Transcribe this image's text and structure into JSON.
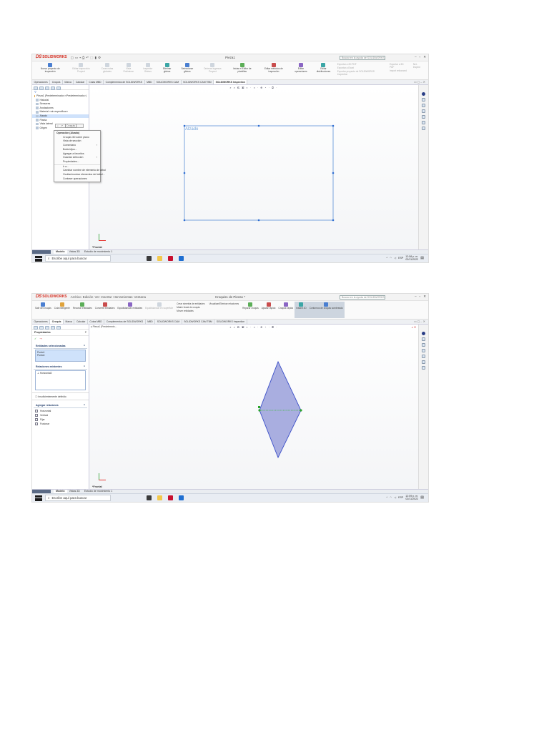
{
  "shot1": {
    "logo": "SOLIDWORKS",
    "doc_title": "Pieza1",
    "search_placeholder": "Buscar en la ayuda de SOLIDWORKS",
    "ribbon": [
      {
        "label": "Nuevo proyecto de inspección",
        "dim": false
      },
      {
        "label": "Editar inspección Proyect",
        "dim": true
      },
      {
        "label": "Crear notas globales",
        "dim": true
      },
      {
        "label": "Vista Preliminar",
        "dim": true
      },
      {
        "label": "Inspector Globos",
        "dim": true
      },
      {
        "label": "Eliminar globos",
        "dim": false
      },
      {
        "label": "Seleccionar globos",
        "dim": false
      },
      {
        "label": "Ordenar ingresos Proyect",
        "dim": true
      },
      {
        "label": "Iniciar el Editor de plantillas",
        "dim": false
      },
      {
        "label": "Editar métodos de inspección",
        "dim": false
      },
      {
        "label": "Editar operaciones",
        "dim": false
      },
      {
        "label": "Editar distribuciones",
        "dim": false
      }
    ],
    "ribbon_col1": [
      "Exportar a 2D PDF",
      "Exportar a Excel",
      "Exportar proyecto de SOLIDWORKS Inspection"
    ],
    "ribbon_col2": [
      "Exportar a 3D PDF",
      "Import enhanced"
    ],
    "ribbon_col3": [
      "Net-Inspect"
    ],
    "tabs": [
      "Operaciones",
      "Croquis",
      "Marca",
      "Calcular",
      "Cotas MBD",
      "Complementos de SOLIDWORKS",
      "MBD",
      "SOLIDWORKS CAM",
      "SOLIDWORKS CAM TBM",
      "SOLIDWORKS Inspection"
    ],
    "active_tab": 9,
    "tree": [
      "Pieza1 (Predeterminado<<Predeterminado>)",
      "Historial",
      "Sensores",
      "Anotaciones",
      "Material <sin especificar>",
      "Alzado",
      "Planta",
      "Vista lateral",
      "Origen"
    ],
    "ctx_mini": "Croquis",
    "menu_head": "Operación (Alzado)",
    "menu": [
      {
        "label": "Croquis 3D sobre plano",
        "arrow": false
      },
      {
        "label": "Vista de sección",
        "arrow": false
      },
      {
        "label": "Comentario",
        "arrow": true
      },
      {
        "label": "Botón/Ajus...",
        "arrow": false
      },
      {
        "label": "Agregar a favoritos",
        "arrow": false
      },
      {
        "label": "Guardar selección",
        "arrow": true
      },
      {
        "label": "Propiedades...",
        "arrow": false
      },
      {
        "label": "Ir a...",
        "arrow": false
      },
      {
        "label": "Cambiar nombre de elemento de árbol",
        "arrow": false
      },
      {
        "label": "Ocultar/mostrar elementos del árbol...",
        "arrow": false
      },
      {
        "label": "Contraer operaciones",
        "arrow": false
      }
    ],
    "sketch_label": "Alzado",
    "plane_label": "*Frontal",
    "bottom_tabs": [
      "Modelo",
      "Vistas 3D",
      "Estudio de movimiento 1"
    ],
    "status_left": "Crea un nuevo croquis o edita un croquis existente.",
    "status_right": "Editando Pieza",
    "status_units": "MMGS"
  },
  "shot2": {
    "logo": "SOLIDWORKS",
    "menubar": [
      "Archivo",
      "Edición",
      "Ver",
      "Insertar",
      "Herramientas",
      "Ventana"
    ],
    "doc_title": "Croquis1 de Pieza1 *",
    "search_placeholder": "Buscar en la ayuda de SOLIDWORKS",
    "ribbon": [
      {
        "label": "Salir del croquis",
        "dim": false
      },
      {
        "label": "Cota inteligente",
        "dim": false
      },
      {
        "label": "Recortar entidades",
        "dim": false
      },
      {
        "label": "Convertir entidades",
        "dim": false
      },
      {
        "label": "Equidistanciar entidades",
        "dim": false
      },
      {
        "label": "Equidistanciar en superficie",
        "dim": true
      }
    ],
    "ribbon_col1": [
      "Crear simetría de entidades",
      "Matriz lineal de croquis",
      "Mover entidades"
    ],
    "ribbon_col2": [
      "Visualizar/Eliminar relaciones"
    ],
    "ribbon_tail": [
      {
        "label": "Reparar croquis",
        "dim": false
      },
      {
        "label": "Ajustar rápido",
        "dim": false
      },
      {
        "label": "Croquis rápido",
        "dim": false
      },
      {
        "label": "Instant 2D",
        "dim": false
      },
      {
        "label": "Contornos de croquis sombreado",
        "dim": false
      }
    ],
    "tabs": [
      "Operaciones",
      "Croquis",
      "Marca",
      "Calcular",
      "Cotas MBD",
      "Complementos de SOLIDWORKS",
      "MBD",
      "SOLIDWORKS CAM",
      "SOLIDWORKS CAM TBM",
      "SOLIDWORKS Inspection"
    ],
    "active_tab": 1,
    "prop_title": "Propiedades",
    "sec_selected": "Entidades seleccionadas",
    "selected": [
      "Punto1",
      "Punto4"
    ],
    "sec_existing": "Relaciones existentes",
    "existing": [
      "Horizontal2"
    ],
    "prop_status": "Insuficientemente definido",
    "sec_add": "Agregar relaciones",
    "add_rel": [
      "Horizontal",
      "Vertical",
      "Fijar",
      "Fusionar"
    ],
    "breadcrumb": "Pieza1 (Predetermin...",
    "plane_label": "*Frontal",
    "bottom_tabs": [
      "Modelo",
      "Vistas 3D",
      "Estudio de movimiento 1"
    ],
    "status_left": "SOLIDWORKS Premium 2020 SP1.0",
    "status_mid": "Distancia: 52.89mm   dX: -52.89mm   dY: 0mm   dZ: 0mm",
    "status_right": "Insuficientemente definido    Editando Croquis1",
    "status_units": "MMGS"
  },
  "taskbar": {
    "search_text": "Escribe aquí para buscar",
    "time": "12:58 p. m.",
    "time2": "12:59 p. m.",
    "date": "02/11/2022",
    "lang": "ESP"
  },
  "colors": {
    "sketch_blue": "#3b6fd8",
    "diamond_fill": "#a9aee0",
    "solidworks_red": "#d52b1e"
  }
}
